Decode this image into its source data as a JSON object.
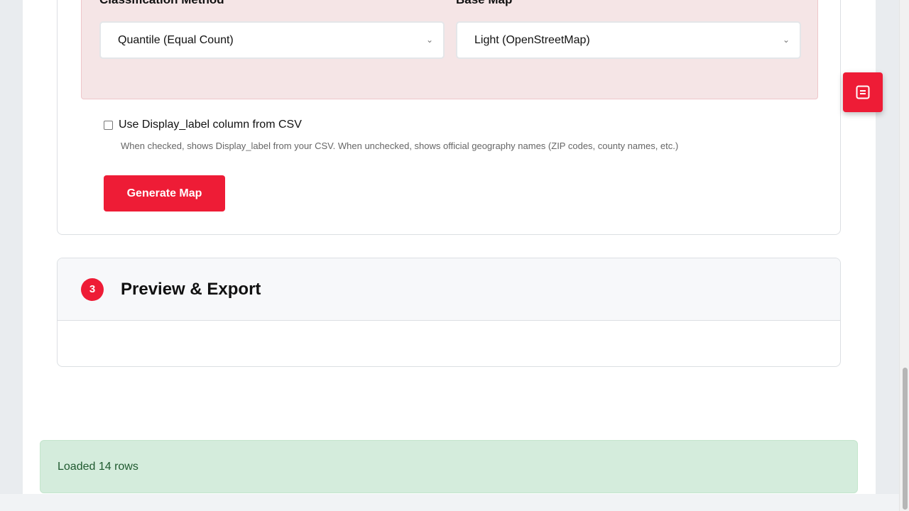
{
  "section2": {
    "classification": {
      "label": "Classification Method",
      "value": "Quantile (Equal Count)"
    },
    "basemap": {
      "label": "Base Map",
      "value": "Light (OpenStreetMap)"
    },
    "display_label_checkbox": {
      "label": "Use Display_label column from CSV",
      "checked": false,
      "help": "When checked, shows Display_label from your CSV. When unchecked, shows official geography names (ZIP codes, county names, etc.)"
    },
    "generate_button": "Generate Map"
  },
  "section3": {
    "step": "3",
    "title": "Preview & Export"
  },
  "status": {
    "message": "Loaded 14 rows"
  },
  "fab": {
    "icon": "document-icon"
  },
  "colors": {
    "accent": "#ee1c36",
    "panel": "#f5e5e6",
    "success_bg": "#d4ecdc",
    "success_text": "#1f5a2f"
  }
}
